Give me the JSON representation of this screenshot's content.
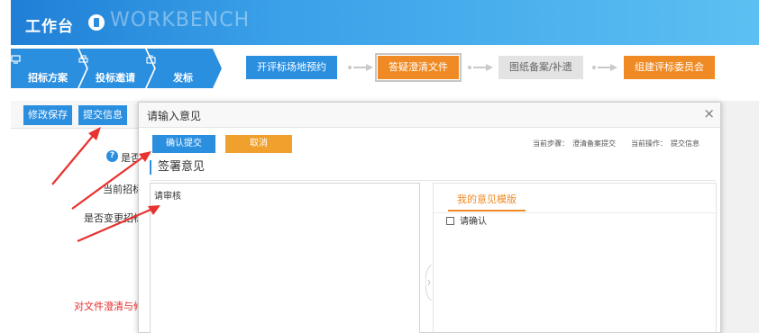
{
  "header": {
    "title": "工作台",
    "subtitle": "WORKBENCH",
    "logo_icon": "power-logo-icon",
    "gradient": [
      "#1f7fd6",
      "#5cc0f2"
    ]
  },
  "stepper": {
    "phases": [
      {
        "label": "招标方案",
        "icon": "monitor-icon"
      },
      {
        "label": "投标邀请",
        "icon": "printer-icon"
      },
      {
        "label": "发标",
        "icon": "briefcase-icon"
      }
    ],
    "steps": [
      {
        "label": "开评标场地预约",
        "state": "done"
      },
      {
        "label": "答疑澄清文件",
        "state": "current"
      },
      {
        "label": "图纸备案/补遗",
        "state": "pending"
      },
      {
        "label": "组建评标委员会",
        "state": "todo"
      }
    ],
    "colors": {
      "blue": "#2b8fe0",
      "orange": "#f08a24",
      "gray": "#e3e3e3"
    }
  },
  "toolbar": {
    "save_label": "修改保存",
    "submit_label": "提交信息"
  },
  "form": {
    "question_text": "是否",
    "label_current": "当前招标",
    "label_change": "是否变更招标",
    "note_red": "对文件澄清与修"
  },
  "modal": {
    "title": "请输入意见",
    "close_icon": "close-icon",
    "confirm_label": "确认提交",
    "cancel_label": "取消",
    "step_label": "当前步骤：",
    "step_value": "澄清备案提交",
    "operation_label": "当前操作：",
    "operation_value": "提交信息",
    "section_title": "签署意见",
    "opinion_value": "请审核",
    "template_tab": "我的意见模版",
    "template_items": [
      {
        "label": "请确认",
        "checked": false
      }
    ]
  },
  "annotations": {
    "arrow_color": "#e8322f"
  }
}
